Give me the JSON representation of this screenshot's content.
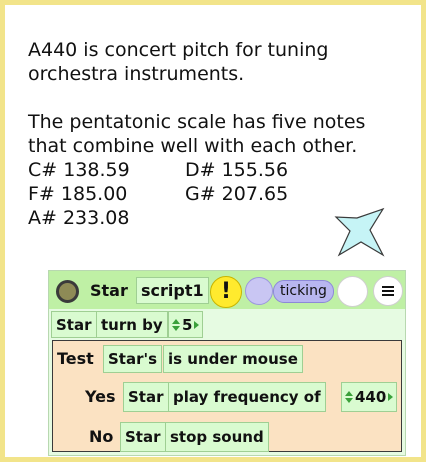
{
  "text": {
    "line1": "A440 is concert pitch for tuning",
    "line2": "orchestra instruments.",
    "line3": "The pentatonic scale has five notes",
    "line4": "that combine well with each other.",
    "notes": [
      [
        "C# 138.59",
        "D# 155.56"
      ],
      [
        "F# 185.00",
        "G# 207.65"
      ],
      [
        "A# 233.08",
        ""
      ]
    ]
  },
  "script": {
    "header": {
      "object_name": "Star",
      "script_name": "script1",
      "bang": "!",
      "status": "ticking"
    },
    "command": {
      "object": "Star",
      "verb": "turn by",
      "amount": "5"
    },
    "test": {
      "test_label": "Test",
      "yes_label": "Yes",
      "no_label": "No",
      "condition_object": "Star's",
      "condition": "is under mouse",
      "yes_object": "Star",
      "yes_command": "play frequency of",
      "yes_value": "440",
      "no_object": "Star",
      "no_command": "stop sound"
    }
  },
  "colors": {
    "border": "#f2e48a",
    "script_bg": "#e6fbe2",
    "header_bg": "#bff0a5",
    "test_bg": "#fbe2c2",
    "star_fill": "#c6f4f6"
  }
}
